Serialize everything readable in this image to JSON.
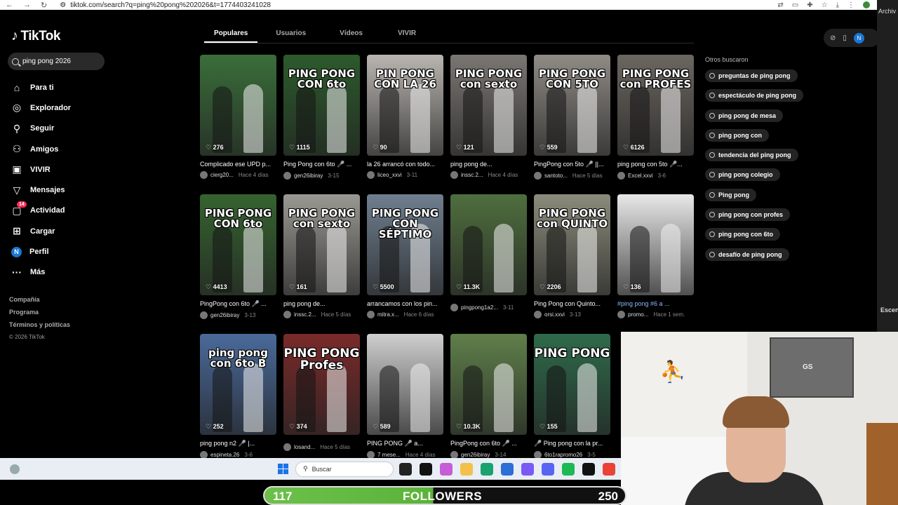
{
  "browser": {
    "url": "tiktok.com/search?q=ping%20pong%202026&t=1774403241028",
    "right_label": "Archiv",
    "escen_label": "Escen"
  },
  "app": {
    "logo": "TikTok"
  },
  "search": {
    "value": "ping pong 2026"
  },
  "sidebar": {
    "items": [
      {
        "label": "Para ti",
        "icon": "home-icon"
      },
      {
        "label": "Explorador",
        "icon": "compass-icon"
      },
      {
        "label": "Seguir",
        "icon": "user-follow-icon"
      },
      {
        "label": "Amigos",
        "icon": "friends-icon"
      },
      {
        "label": "VIVIR",
        "icon": "live-icon"
      },
      {
        "label": "Mensajes",
        "icon": "send-icon"
      },
      {
        "label": "Actividad",
        "icon": "inbox-icon",
        "badge": "14"
      },
      {
        "label": "Cargar",
        "icon": "upload-icon"
      },
      {
        "label": "Perfil",
        "icon": "avatar-icon",
        "avatar_letter": "N"
      },
      {
        "label": "Más",
        "icon": "more-icon"
      }
    ],
    "footer": [
      "Compañía",
      "Programa",
      "Términos y políticas",
      "© 2026 TikTok"
    ]
  },
  "tabs": [
    "Populares",
    "Usuarios",
    "Vídeos",
    "VIVIR"
  ],
  "videos": [
    {
      "likes": "276",
      "caption": "Complicado ese UPD p...",
      "author": "cierg20...",
      "date": "Hace 4 días",
      "overlay": "",
      "bg": "#3a6e3a"
    },
    {
      "likes": "1115",
      "caption": "Ping Pong con 6to 🎤 ...",
      "author": "gen26ibiray",
      "date": "3-15",
      "overlay": "PING PONG CON 6to",
      "bg": "#2c5a2c"
    },
    {
      "likes": "90",
      "caption": "la 26 arrancó con todo...",
      "author": "liceo_xxvi",
      "date": "3-11",
      "overlay": "PIN PONG CON LA 26",
      "bg": "#b9b5b0"
    },
    {
      "likes": "121",
      "caption": "ping pong de...",
      "author": "inssc.2...",
      "date": "Hace 4 días",
      "overlay": "PING PONG con sexto",
      "bg": "#7a7672"
    },
    {
      "likes": "559",
      "caption": "PingPong con 5to 🎤 ||...",
      "author": "santoto...",
      "date": "Hace 5 días",
      "overlay": "PING PONG CON 5TO",
      "bg": "#8f8b85"
    },
    {
      "likes": "6126",
      "caption": "ping pong con 5to 🎤...",
      "author": "Excel.xxvi",
      "date": "3-6",
      "overlay": "PING PONG con PROFES",
      "bg": "#6b6660"
    },
    {
      "likes": "4413",
      "caption": "PingPong con 6to 🎤 ...",
      "author": "gen26ibiray",
      "date": "3-13",
      "overlay": "PING PONG CON 6to",
      "bg": "#35632f"
    },
    {
      "likes": "161",
      "caption": "ping pong de...",
      "author": "inssc.2...",
      "date": "Hace 5 días",
      "overlay": "PING PONG con sexto",
      "bg": "#9a9892"
    },
    {
      "likes": "5500",
      "caption": "arrancamos con los pin...",
      "author": "mitra.x...",
      "date": "Hace 6 días",
      "overlay": "PING PONG CON SÉPTIMO",
      "bg": "#6f7f8f"
    },
    {
      "likes": "11.3K",
      "caption": "",
      "author": "pingpong1a2...",
      "date": "3-11",
      "overlay": "",
      "bg": "#4f6e3e"
    },
    {
      "likes": "2206",
      "caption": "Ping Pong con Quinto...",
      "author": "orsi.xxvi",
      "date": "3-13",
      "overlay": "PING PONG con QUINTO",
      "bg": "#8c8c7c"
    },
    {
      "likes": "136",
      "caption": "#ping pong #6 a ...",
      "author": "promo...",
      "date": "Hace 1 sem.",
      "overlay": "",
      "bg": "#e8e8e8"
    },
    {
      "likes": "252",
      "caption": "ping pong n2 🎤 |...",
      "author": "espineta.26",
      "date": "3-6",
      "overlay": "ping pong con 6to B",
      "bg": "#4a6a9a"
    },
    {
      "likes": "374",
      "caption": "",
      "author": "losand...",
      "date": "Hace 5 días",
      "overlay": "PING PONG Profes",
      "bg": "#7a2a2a"
    },
    {
      "likes": "589",
      "caption": "PING PONG 🎤 a...",
      "author": "7 mese...",
      "date": "Hace 4 días",
      "overlay": "",
      "bg": "#cfcfcf"
    },
    {
      "likes": "10.3K",
      "caption": "PingPong con 6to 🎤 ...",
      "author": "gen26ibiray",
      "date": "3-14",
      "overlay": "",
      "bg": "#5f7f4a"
    },
    {
      "likes": "155",
      "caption": "🎤 Ping pong con la pr...",
      "author": "6to1rapromo26",
      "date": "3-5",
      "overlay": "PING PONG",
      "bg": "#2f6a4a"
    }
  ],
  "others": {
    "title": "Otros buscaron",
    "items": [
      "preguntas de ping pong",
      "espectáculo de ping pong",
      "ping pong de mesa",
      "ping pong con",
      "tendencia del ping pong",
      "ping pong colegio",
      "Ping pong",
      "ping pong con profes",
      "ping pong con 6to",
      "desafío de ping pong"
    ]
  },
  "top_right": {
    "avatar_letter": "N"
  },
  "taskbar": {
    "search_placeholder": "Buscar"
  },
  "webcam": {
    "jersey_text": "GS"
  },
  "followers": {
    "current": "117",
    "label": "FOLLOWERS",
    "goal": "250",
    "progress_fraction": 0.468
  }
}
